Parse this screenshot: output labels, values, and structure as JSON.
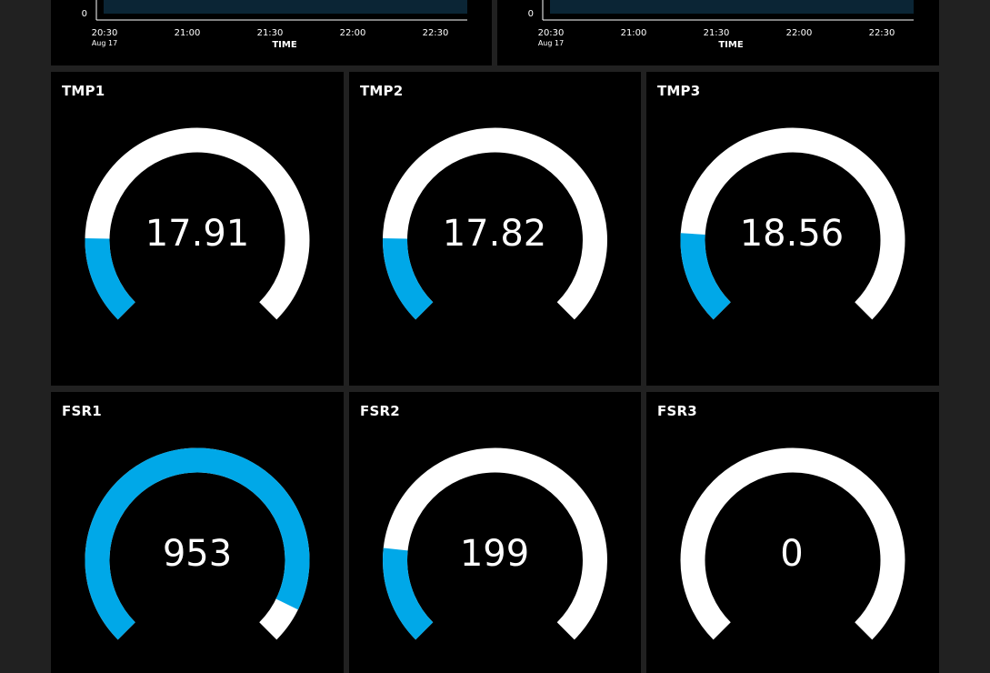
{
  "colors": {
    "page_bg": "#212121",
    "panel_bg": "#000000",
    "gauge_fill": "#00a8e8",
    "gauge_track": "#ffffff",
    "chart_plot": "#0b2535",
    "text": "#ffffff"
  },
  "charts": [
    {
      "y_tick_label": "0",
      "x_ticks": [
        "20:30",
        "21:00",
        "21:30",
        "22:00",
        "22:30"
      ],
      "x_sub_label": "Aug 17",
      "x_axis_title": "TIME"
    },
    {
      "y_tick_label": "0",
      "x_ticks": [
        "20:30",
        "21:00",
        "21:30",
        "22:00",
        "22:30"
      ],
      "x_sub_label": "Aug 17",
      "x_axis_title": "TIME"
    }
  ],
  "gauges": [
    {
      "title": "TMP1",
      "value": "17.91",
      "fill_fraction": 0.17
    },
    {
      "title": "TMP2",
      "value": "17.82",
      "fill_fraction": 0.17
    },
    {
      "title": "TMP3",
      "value": "18.56",
      "fill_fraction": 0.18
    },
    {
      "title": "FSR1",
      "value": "953",
      "fill_fraction": 0.93
    },
    {
      "title": "FSR2",
      "value": "199",
      "fill_fraction": 0.19
    },
    {
      "title": "FSR3",
      "value": "0",
      "fill_fraction": 0.0
    }
  ]
}
